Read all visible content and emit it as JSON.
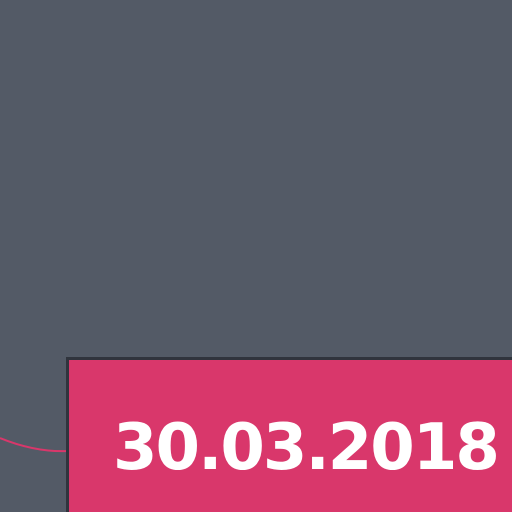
{
  "card": {
    "date": "30.03.2018"
  },
  "colors": {
    "background": "#535a66",
    "card_fill": "#d9376b",
    "card_border": "#30343d",
    "connector": "#d9376b",
    "text": "#ffffff"
  }
}
